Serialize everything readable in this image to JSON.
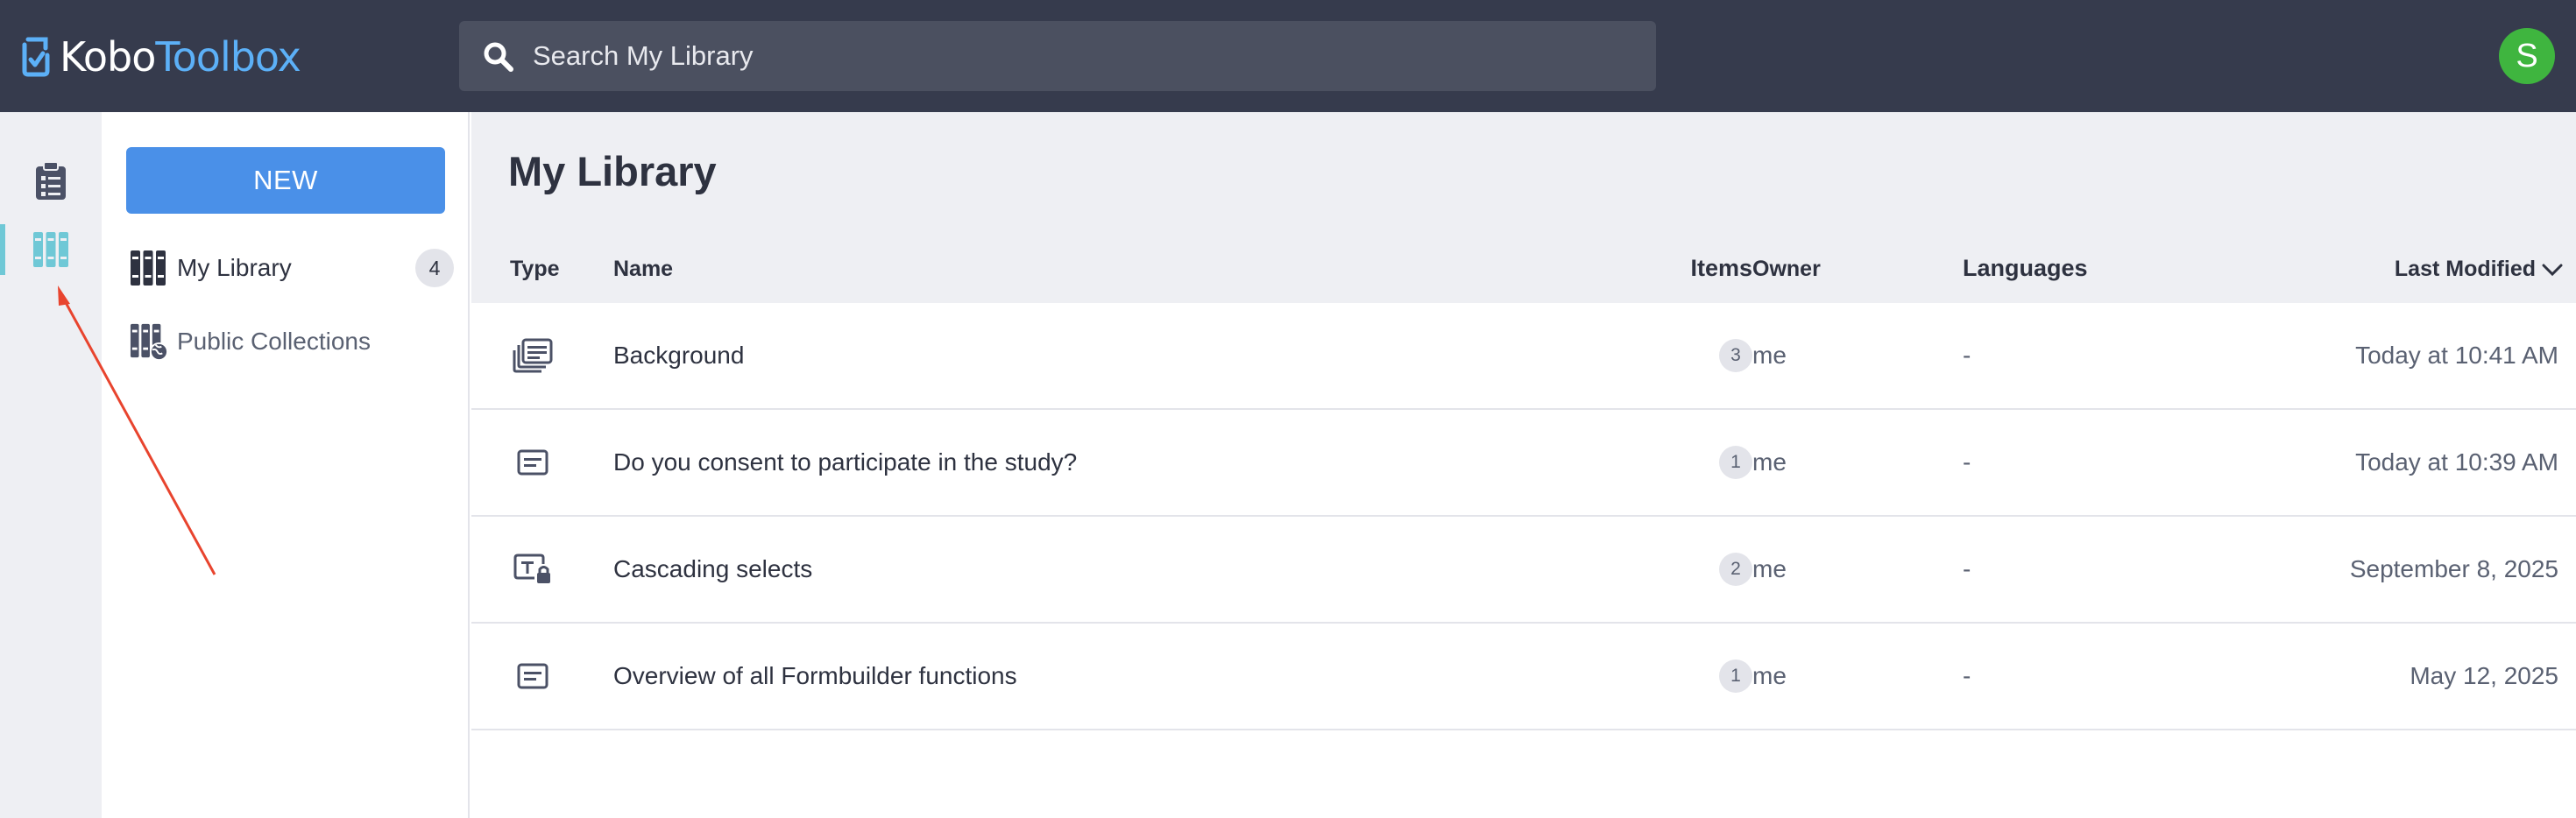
{
  "app": {
    "logo_part1": "Kobo",
    "logo_part2": "Toolbox",
    "user_initial": "S"
  },
  "search": {
    "placeholder": "Search My Library"
  },
  "rail": {
    "items": [
      {
        "icon": "projects-clipboard-icon",
        "active": false
      },
      {
        "icon": "library-books-icon",
        "active": true
      }
    ]
  },
  "sidebar": {
    "new_label": "NEW",
    "links": [
      {
        "label": "My Library",
        "count": "4",
        "icon": "library-books-icon"
      },
      {
        "label": "Public Collections",
        "icon": "public-collections-icon"
      }
    ]
  },
  "main": {
    "title": "My Library",
    "columns": {
      "type": "Type",
      "name": "Name",
      "items": "Items",
      "owner": "Owner",
      "languages": "Languages",
      "last_modified": "Last Modified"
    },
    "rows": [
      {
        "type_icon": "block-icon",
        "name": "Background",
        "items": "3",
        "owner": "me",
        "languages": "-",
        "modified": "Today at 10:41 AM"
      },
      {
        "type_icon": "question-icon",
        "name": "Do you consent to participate in the study?",
        "items": "1",
        "owner": "me",
        "languages": "-",
        "modified": "Today at 10:39 AM"
      },
      {
        "type_icon": "locked-template-icon",
        "name": "Cascading selects",
        "items": "2",
        "owner": "me",
        "languages": "-",
        "modified": "September 8, 2025"
      },
      {
        "type_icon": "question-icon",
        "name": "Overview of all Formbuilder functions",
        "items": "1",
        "owner": "me",
        "languages": "-",
        "modified": "May 12, 2025"
      }
    ]
  },
  "colors": {
    "topbar": "#363b4d",
    "accent_blue": "#4a90e8",
    "avatar_green": "#3fb53f",
    "active_teal": "#6fc8d6",
    "annotation_red": "#e8442e"
  }
}
